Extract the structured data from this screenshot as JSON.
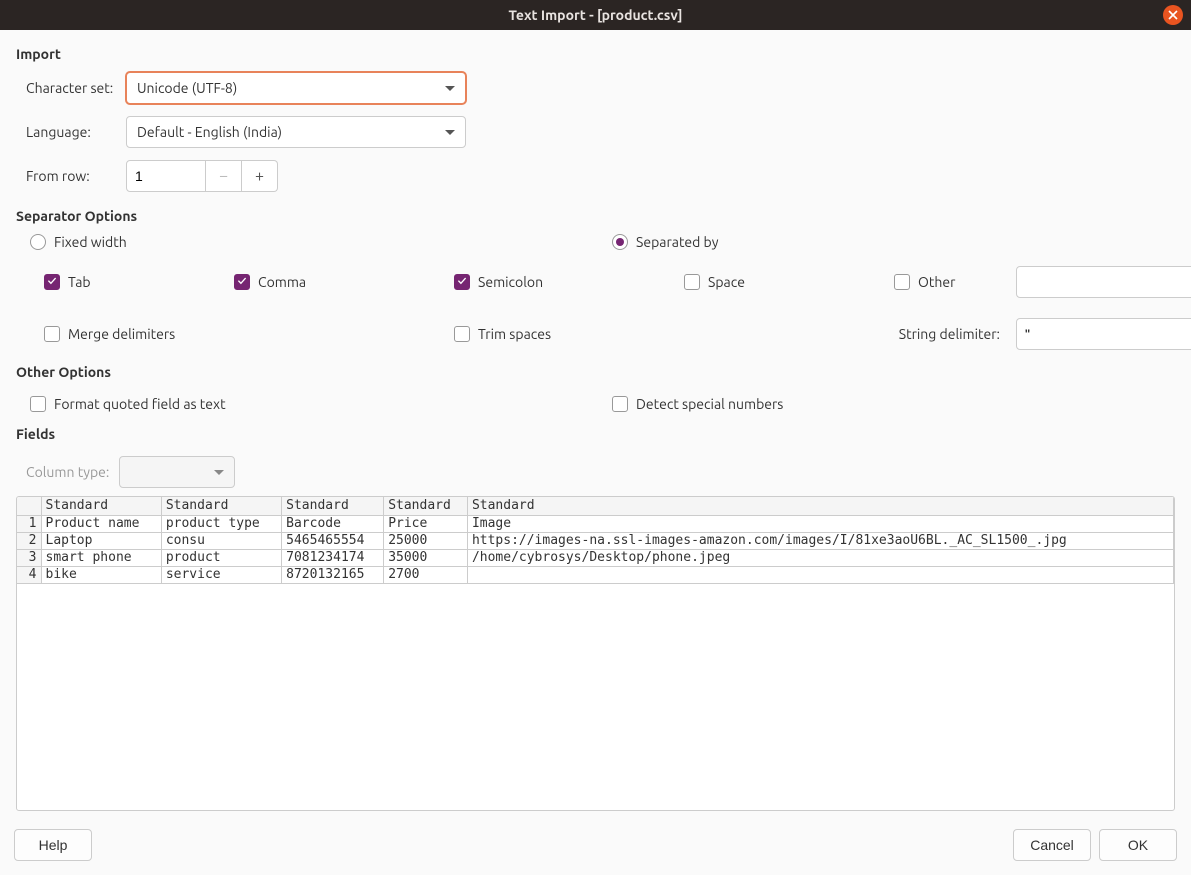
{
  "window": {
    "title": "Text Import - [product.csv]"
  },
  "sections": {
    "import": "Import",
    "separator": "Separator Options",
    "other": "Other Options",
    "fields": "Fields"
  },
  "import": {
    "charset_label": "Character set:",
    "charset_value": "Unicode (UTF-8)",
    "language_label": "Language:",
    "language_value": "Default - English (India)",
    "fromrow_label": "From row:",
    "fromrow_value": "1"
  },
  "separator": {
    "fixed_width": "Fixed width",
    "separated_by": "Separated by",
    "tab": "Tab",
    "comma": "Comma",
    "semicolon": "Semicolon",
    "space": "Space",
    "other": "Other",
    "other_value": "",
    "merge": "Merge delimiters",
    "trim": "Trim spaces",
    "string_delim_label": "String delimiter:",
    "string_delim_value": "\""
  },
  "other": {
    "format_quoted": "Format quoted field as text",
    "detect_special": "Detect special numbers"
  },
  "fields": {
    "coltype_label": "Column type:",
    "headers": [
      "",
      "Standard",
      "Standard",
      "Standard",
      "Standard",
      "Standard"
    ],
    "rows": [
      [
        "1",
        "Product name",
        "product type",
        "Barcode",
        "Price",
        "Image"
      ],
      [
        "2",
        "Laptop",
        "consu",
        "5465465554",
        "25000",
        "https://images-na.ssl-images-amazon.com/images/I/81xe3aoU6BL._AC_SL1500_.jpg"
      ],
      [
        "3",
        "smart phone",
        "product",
        "7081234174",
        "35000",
        "/home/cybrosys/Desktop/phone.jpeg"
      ],
      [
        "4",
        "bike",
        "service",
        "8720132165",
        "2700",
        ""
      ]
    ]
  },
  "footer": {
    "help": "Help",
    "cancel": "Cancel",
    "ok": "OK"
  }
}
